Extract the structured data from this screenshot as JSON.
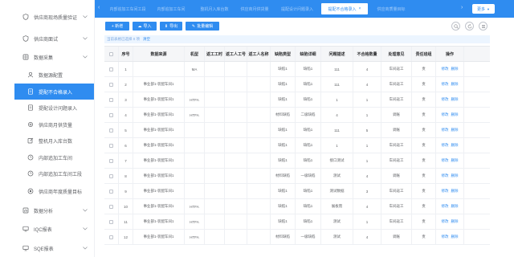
{
  "sidebar": {
    "items": [
      {
        "label": "供应商现场质量验证",
        "icon": "shield-icon",
        "expand": true
      },
      {
        "label": "供应商面试",
        "icon": "shield-icon",
        "expand": true
      },
      {
        "label": "数据采集",
        "icon": "grid-icon",
        "expand": true
      },
      {
        "label": "数据源配置",
        "icon": "user-icon",
        "sub": true
      },
      {
        "label": "提配不合格录入",
        "icon": "document-icon",
        "sub": true,
        "active": true
      },
      {
        "label": "提配设计问题录入",
        "icon": "document-icon",
        "sub": true
      },
      {
        "label": "供应商月供货量",
        "icon": "gear-icon",
        "sub": true
      },
      {
        "label": "整机月入库台数",
        "icon": "edit-icon",
        "sub": true
      },
      {
        "label": "内部追加工车间",
        "icon": "clock-icon",
        "sub": true
      },
      {
        "label": "内部追加工车间工段",
        "icon": "clock-icon",
        "sub": true
      },
      {
        "label": "供应商年度质量目标",
        "icon": "settings-icon",
        "sub": true
      },
      {
        "label": "数据分析",
        "icon": "chart-icon",
        "expand": true
      },
      {
        "label": "IQC报表",
        "icon": "monitor-icon",
        "expand": true
      },
      {
        "label": "SQE报表",
        "icon": "monitor-icon",
        "expand": true
      }
    ]
  },
  "tabs": [
    {
      "label": "内部追加工车间工段"
    },
    {
      "label": "内部追加工车间"
    },
    {
      "label": "整机月入库台数"
    },
    {
      "label": "供应商月供货量"
    },
    {
      "label": "提配设计问题录入"
    },
    {
      "label": "提配不合格录入",
      "active": true
    },
    {
      "label": "供应商质量目标"
    }
  ],
  "more_label": "更多",
  "toolbar": {
    "add": "+ 新增",
    "import": "导入",
    "export": "导出",
    "batch_edit": "批量编辑"
  },
  "selection": {
    "text": "当前表格已选择 0 项",
    "clear": "清空"
  },
  "table": {
    "columns": [
      "",
      "序号",
      "数据来源",
      "机型",
      "返工工时",
      "返工人工号",
      "返工人名称",
      "缺陷类型",
      "缺陷详细",
      "问题描述",
      "不合格数量",
      "处理意见",
      "责任班组",
      "操作"
    ],
    "rows": [
      {
        "n": "1",
        "src": "",
        "model": "MA",
        "type": "缺陷1",
        "detail": "缺陷1",
        "desc": "111",
        "qty": "4",
        "opinion": "车间返工",
        "team": "责"
      },
      {
        "n": "2",
        "src": "事业部1-装配车间1",
        "model": "",
        "type": "缺陷1",
        "detail": "缺陷1",
        "desc": "111",
        "qty": "4",
        "opinion": "车间返工",
        "team": "责"
      },
      {
        "n": "3",
        "src": "事业部1-装配车间1",
        "model": "HTFA",
        "type": "缺陷1",
        "detail": "缺陷1",
        "desc": "1",
        "qty": "1",
        "opinion": "车间返工",
        "team": "责"
      },
      {
        "n": "4",
        "src": "事业部1-装配车间1",
        "model": "HTFA",
        "type": "材料缺陷",
        "detail": "二级缺陷",
        "desc": "4",
        "qty": "1",
        "opinion": "调账",
        "team": "责"
      },
      {
        "n": "5",
        "src": "事业部1-装配车间1",
        "model": "",
        "type": "缺陷1",
        "detail": "缺陷1",
        "desc": "111",
        "qty": "5",
        "opinion": "调账",
        "team": "责"
      },
      {
        "n": "6",
        "src": "事业部1-装配车间1",
        "model": "",
        "type": "缺陷1",
        "detail": "缺陷1",
        "desc": "1",
        "qty": "1",
        "opinion": "车间返工",
        "team": "责"
      },
      {
        "n": "7",
        "src": "事业部1-装配车间1",
        "model": "",
        "type": "缺陷1",
        "detail": "缺陷1",
        "desc": "接口测试",
        "qty": "1",
        "opinion": "车间返工",
        "team": "责"
      },
      {
        "n": "8",
        "src": "事业部1-装配车间1",
        "model": "",
        "type": "材料缺陷",
        "detail": "一级缺陷",
        "desc": "测试",
        "qty": "4",
        "opinion": "调账",
        "team": "责"
      },
      {
        "n": "9",
        "src": "事业部1-装配车间1",
        "model": "",
        "type": "缺陷1",
        "detail": "缺陷1",
        "desc": "测试数据",
        "qty": "3",
        "opinion": "车间返工",
        "team": "责"
      },
      {
        "n": "10",
        "src": "事业部1-装配车间1",
        "model": "HTFA",
        "type": "缺陷1",
        "detail": "缺陷1",
        "desc": "展板而",
        "qty": "4",
        "opinion": "车间返工",
        "team": "责"
      },
      {
        "n": "11",
        "src": "事业部1-装配车间1",
        "model": "HTFA",
        "type": "缺陷1",
        "detail": "缺陷1",
        "desc": "测试",
        "qty": "1",
        "opinion": "车间返工",
        "team": "责"
      },
      {
        "n": "12",
        "src": "事业部1-装配车间1",
        "model": "HTFA",
        "type": "材料缺陷",
        "detail": "一级缺陷",
        "desc": "测试",
        "qty": "4",
        "opinion": "调账",
        "team": "责"
      }
    ],
    "op_edit": "修改",
    "op_delete": "删除"
  }
}
